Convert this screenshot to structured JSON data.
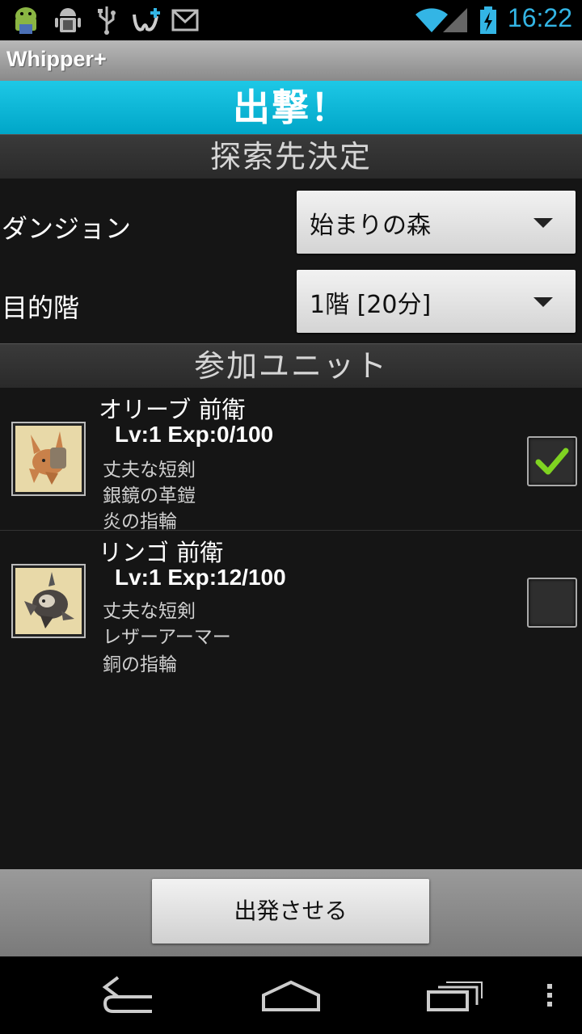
{
  "status_bar": {
    "time": "16:22",
    "icons": [
      "android-icon",
      "android-debug-icon",
      "usb-icon",
      "whipper-notification-icon",
      "gmail-icon",
      "wifi-icon",
      "signal-icon",
      "battery-charging-icon"
    ]
  },
  "app": {
    "title": "Whipper+"
  },
  "banner": {
    "text": "出撃！"
  },
  "explore_section": {
    "header": "探索先決定",
    "dungeon": {
      "label": "ダンジョン",
      "value": "始まりの森"
    },
    "floor": {
      "label": "目的階",
      "value": "1階 [20分]"
    }
  },
  "units_section": {
    "header": "参加ユニット",
    "units": [
      {
        "name": "オリーブ 前衛",
        "level": "Lv:1  Exp:0/100",
        "equipment": [
          "丈夫な短剣",
          "銀鏡の革鎧",
          "炎の指輪"
        ],
        "checked": true
      },
      {
        "name": "リンゴ 前衛",
        "level": "Lv:1  Exp:12/100",
        "equipment": [
          "丈夫な短剣",
          "レザーアーマー",
          "銅の指輪"
        ],
        "checked": false
      }
    ]
  },
  "actions": {
    "depart_label": "出発させる"
  },
  "colors": {
    "accent": "#33b5e5",
    "banner": "#00b4d6",
    "check": "#7fd321"
  },
  "nav_bar": {
    "icons": [
      "back-icon",
      "home-icon",
      "recent-apps-icon",
      "overflow-menu-icon"
    ]
  }
}
